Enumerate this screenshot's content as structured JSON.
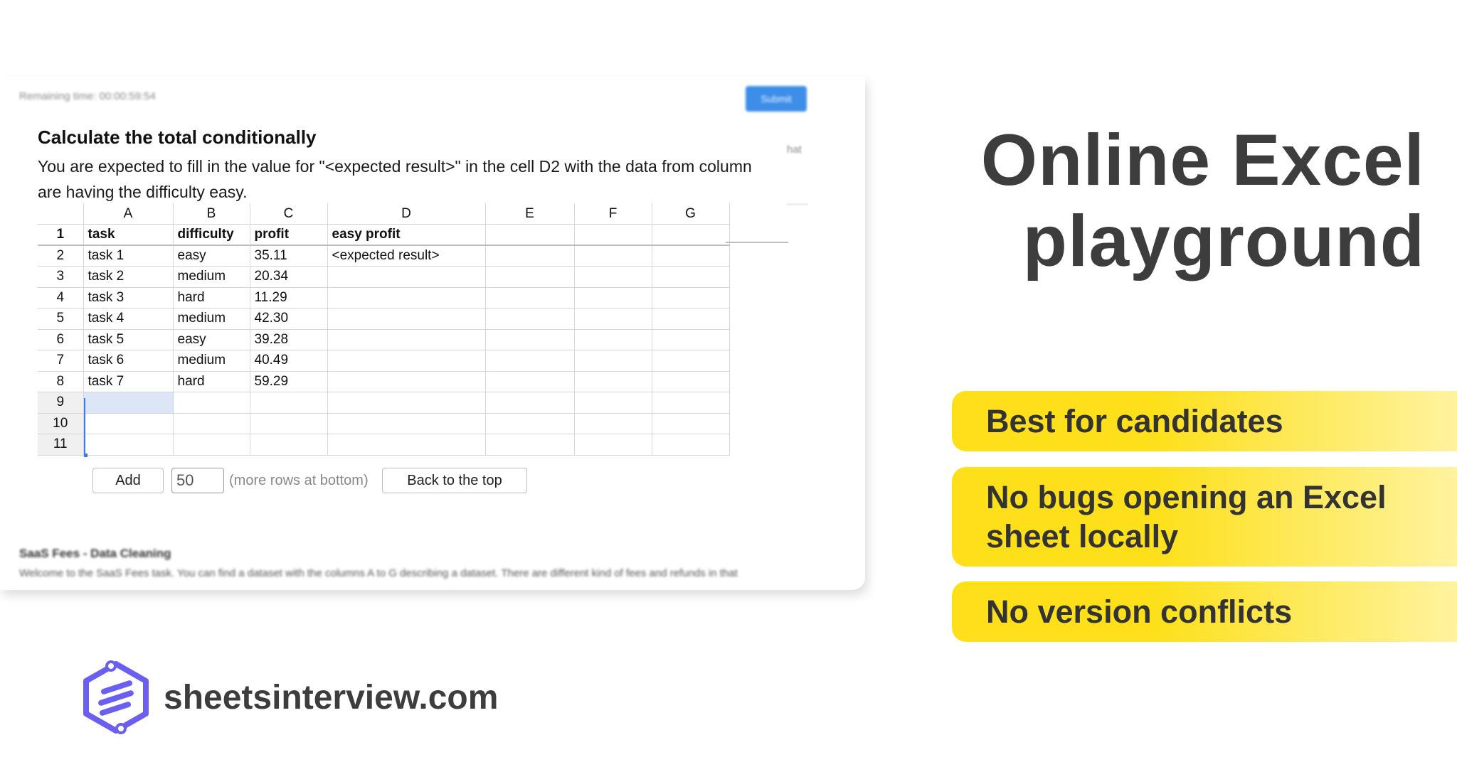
{
  "app": {
    "timer": "Remaining time: 00:00:59:54",
    "submit_label": "Submit",
    "task_title": "Calculate the total conditionally",
    "task_desc_line1": "You are expected to fill in the value for \"<expected result>\" in the cell D2 with the data from column",
    "task_desc_line2": "are having the difficulty easy.",
    "overflow_hint": "hat",
    "columns": [
      "A",
      "B",
      "C",
      "D",
      "E",
      "F",
      "G"
    ],
    "rows": [
      {
        "num": "1",
        "cells": [
          "task",
          "difficulty",
          "profit",
          "easy profit",
          "",
          "",
          ""
        ]
      },
      {
        "num": "2",
        "cells": [
          "task 1",
          "easy",
          "35.11",
          "<expected result>",
          "",
          "",
          ""
        ]
      },
      {
        "num": "3",
        "cells": [
          "task 2",
          "medium",
          "20.34",
          "",
          "",
          "",
          ""
        ]
      },
      {
        "num": "4",
        "cells": [
          "task 3",
          "hard",
          "11.29",
          "",
          "",
          "",
          ""
        ]
      },
      {
        "num": "5",
        "cells": [
          "task 4",
          "medium",
          "42.30",
          "",
          "",
          "",
          ""
        ]
      },
      {
        "num": "6",
        "cells": [
          "task 5",
          "easy",
          "39.28",
          "",
          "",
          "",
          ""
        ]
      },
      {
        "num": "7",
        "cells": [
          "task 6",
          "medium",
          "40.49",
          "",
          "",
          "",
          ""
        ]
      },
      {
        "num": "8",
        "cells": [
          "task 7",
          "hard",
          "59.29",
          "",
          "",
          "",
          ""
        ]
      },
      {
        "num": "9",
        "cells": [
          "",
          "",
          "",
          "",
          "",
          "",
          ""
        ]
      },
      {
        "num": "10",
        "cells": [
          "",
          "",
          "",
          "",
          "",
          "",
          ""
        ]
      },
      {
        "num": "11",
        "cells": [
          "",
          "",
          "",
          "",
          "",
          "",
          ""
        ]
      }
    ],
    "add_label": "Add",
    "rows_to_add": "50",
    "more_rows_label": "(more rows at bottom)",
    "back_to_top_label": "Back to the top",
    "next_task_title": "SaaS Fees - Data Cleaning",
    "next_task_desc": "Welcome to the SaaS Fees task. You can find a dataset with the columns A to G describing a dataset. There are different kind of fees and refunds in that"
  },
  "marketing": {
    "headline_line1": "Online Excel",
    "headline_line2": "playground",
    "features": [
      "Best for candidates",
      "No bugs opening an Excel sheet locally",
      "No version conflicts"
    ]
  },
  "brand": {
    "logo_icon": "sheets-hexagon-icon",
    "name": "sheetsinterview.com",
    "logo_color": "#6a5ff0"
  },
  "colors": {
    "accent_yellow": "#fde01a",
    "submit_blue": "#3d8ee8",
    "selection_blue": "#dde6f7",
    "headline_gray": "#3d3d3d"
  }
}
